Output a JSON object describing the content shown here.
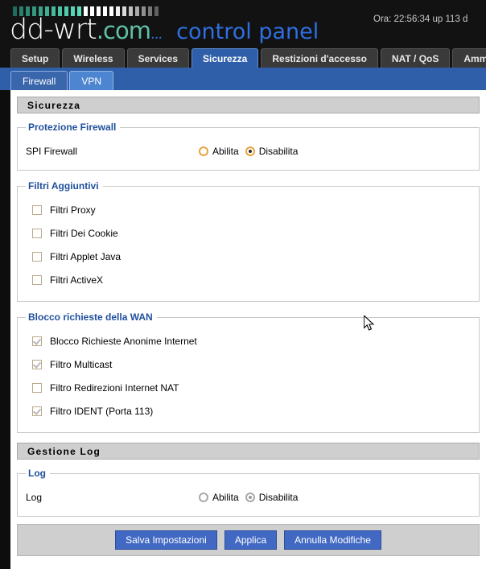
{
  "header": {
    "logo_main": "dd-wrt",
    "logo_suffix": ".com",
    "logo_dots": "...",
    "logo_subtitle": "control panel",
    "clock": "Ora: 22:56:34 up 113 d",
    "bar_colors": [
      "#1f6b5c",
      "#2a7f6c",
      "#2f8a74",
      "#35977e",
      "#3aa288",
      "#3fae92",
      "#45b99c",
      "#4ac2a4",
      "#50cbac",
      "#56d4b4",
      "#5cdcbb",
      "#ffffff",
      "#ffffff",
      "#ffffff",
      "#ffffff",
      "#ffffff",
      "#f0f0f0",
      "#d8d8d8",
      "#c0c0c0",
      "#a8a8a8",
      "#909090",
      "#787878",
      "#606060"
    ]
  },
  "tabs": [
    {
      "label": "Setup",
      "active": false
    },
    {
      "label": "Wireless",
      "active": false
    },
    {
      "label": "Services",
      "active": false
    },
    {
      "label": "Sicurezza",
      "active": true
    },
    {
      "label": "Restizioni d'accesso",
      "active": false
    },
    {
      "label": "NAT / QoS",
      "active": false
    },
    {
      "label": "Amministrazio",
      "active": false
    }
  ],
  "subtabs": [
    {
      "label": "Firewall",
      "active": true
    },
    {
      "label": "VPN",
      "active": false
    }
  ],
  "security_section": {
    "title": "Sicurezza",
    "firewall_protection": {
      "legend": "Protezione Firewall",
      "spi_label": "SPI Firewall",
      "options": [
        {
          "label": "Abilita",
          "selected": false,
          "disabled": false
        },
        {
          "label": "Disabilita",
          "selected": true,
          "disabled": false
        }
      ]
    },
    "additional_filters": {
      "legend": "Filtri Aggiuntivi",
      "items": [
        {
          "label": "Filtri Proxy",
          "checked": false
        },
        {
          "label": "Filtri Dei Cookie",
          "checked": false
        },
        {
          "label": "Filtri Applet Java",
          "checked": false
        },
        {
          "label": "Filtri ActiveX",
          "checked": false
        }
      ]
    },
    "wan_block": {
      "legend": "Blocco richieste della WAN",
      "items": [
        {
          "label": "Blocco Richieste Anonime Internet",
          "checked": true
        },
        {
          "label": "Filtro Multicast",
          "checked": true
        },
        {
          "label": "Filtro Redirezioni Internet NAT",
          "checked": false
        },
        {
          "label": "Filtro IDENT (Porta 113)",
          "checked": true
        }
      ]
    }
  },
  "log_section": {
    "title": "Gestione Log",
    "legend": "Log",
    "log_label": "Log",
    "options": [
      {
        "label": "Abilita",
        "selected": false,
        "disabled": true
      },
      {
        "label": "Disabilita",
        "selected": true,
        "disabled": true
      }
    ]
  },
  "buttons": [
    {
      "label": "Salva Impostazioni"
    },
    {
      "label": "Applica"
    },
    {
      "label": "Annulla Modifiche"
    }
  ],
  "colors": {
    "accent_blue": "#2f5fa8",
    "button_blue": "#4169c4",
    "legend_blue": "#1f4f9c",
    "radio_orange": "#e8a33d"
  }
}
